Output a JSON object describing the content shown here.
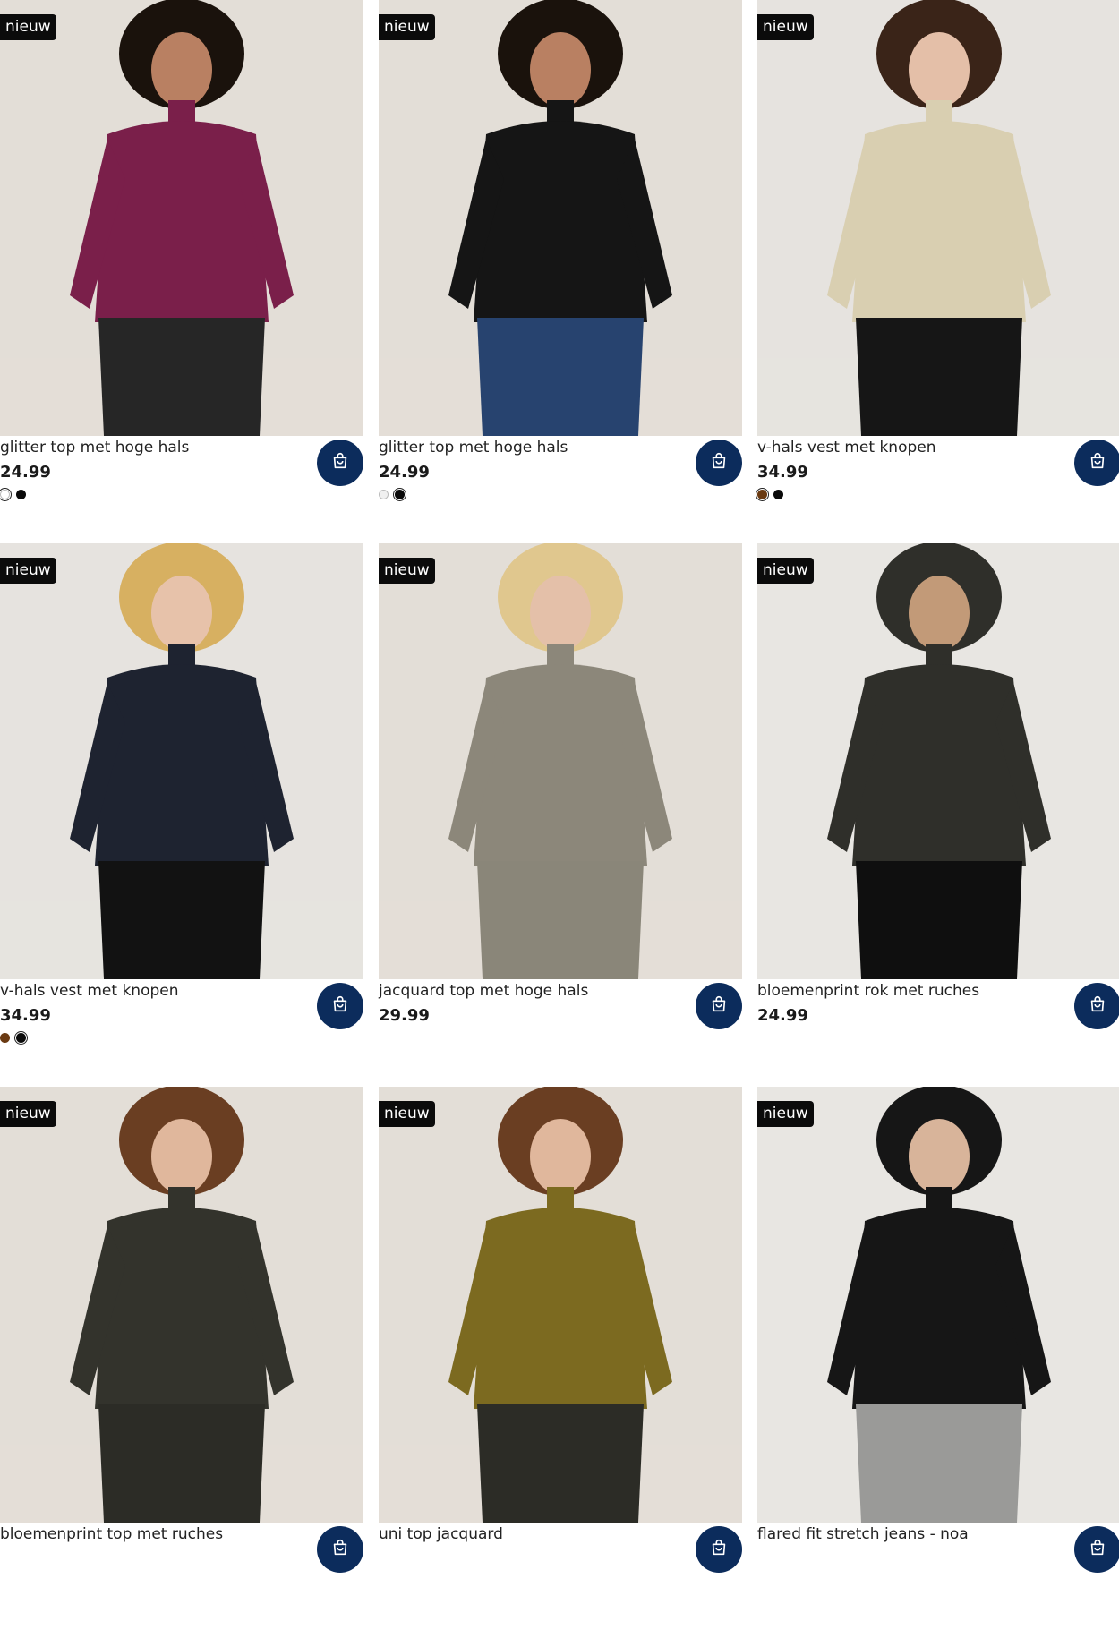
{
  "badge_text": "nieuw",
  "cart_icon": "shopping-bag-icon",
  "products": [
    {
      "title": "glitter top met hoge hals",
      "price": "24.99",
      "swatches": [
        "#ffffff",
        "#0a0a0a"
      ],
      "selected_swatch": 0,
      "top_color": "#7a1f4a",
      "bottom_color": "#262626",
      "hair_color": "#1a120c",
      "skin_color": "#b98062",
      "bg_color": "#e3ded7"
    },
    {
      "title": "glitter top met hoge hals",
      "price": "24.99",
      "swatches": [
        "#f0f0f0",
        "#0a0a0a"
      ],
      "selected_swatch": 1,
      "top_color": "#151515",
      "bottom_color": "#27436f",
      "hair_color": "#1a120c",
      "skin_color": "#b98062",
      "bg_color": "#e3ded7"
    },
    {
      "title": "v-hals vest met knopen",
      "price": "34.99",
      "swatches": [
        "#6a3a12",
        "#0a0a0a"
      ],
      "selected_swatch": 0,
      "top_color": "#d9cfb1",
      "bottom_color": "#161616",
      "hair_color": "#3a2418",
      "skin_color": "#e4bfa8",
      "bg_color": "#e6e3df"
    },
    {
      "title": "v-hals vest met knopen",
      "price": "34.99",
      "swatches": [
        "#6a3a12",
        "#0a0a0a"
      ],
      "selected_swatch": 1,
      "top_color": "#1e2330",
      "bottom_color": "#121212",
      "hair_color": "#d7b061",
      "skin_color": "#e7c2aa",
      "bg_color": "#e6e3df"
    },
    {
      "title": "jacquard top met hoge hals",
      "price": "29.99",
      "swatches": [],
      "selected_swatch": -1,
      "top_color": "#8c877a",
      "bottom_color": "#8a8679",
      "hair_color": "#e0c78e",
      "skin_color": "#e4c0a9",
      "bg_color": "#e3ded7"
    },
    {
      "title": "bloemenprint rok met ruches",
      "price": "24.99",
      "swatches": [],
      "selected_swatch": -1,
      "top_color": "#2f2f2a",
      "bottom_color": "#0f0f0f",
      "hair_color": "#2f2f2a",
      "skin_color": "#c29a78",
      "bg_color": "#e8e6e2"
    },
    {
      "title": "bloemenprint top met ruches",
      "price": "",
      "swatches": [],
      "selected_swatch": -1,
      "top_color": "#33332c",
      "bottom_color": "#2c2c26",
      "hair_color": "#6a3e22",
      "skin_color": "#e0b79c",
      "bg_color": "#e3ded7"
    },
    {
      "title": "uni top jacquard",
      "price": "",
      "swatches": [],
      "selected_swatch": -1,
      "top_color": "#7c6a20",
      "bottom_color": "#2c2c26",
      "hair_color": "#6a3e22",
      "skin_color": "#e0b79c",
      "bg_color": "#e3ded7"
    },
    {
      "title": "flared fit stretch jeans - noa",
      "price": "",
      "swatches": [],
      "selected_swatch": -1,
      "top_color": "#161616",
      "bottom_color": "#9a9a98",
      "hair_color": "#161616",
      "skin_color": "#d8b49a",
      "bg_color": "#e8e6e2"
    }
  ]
}
